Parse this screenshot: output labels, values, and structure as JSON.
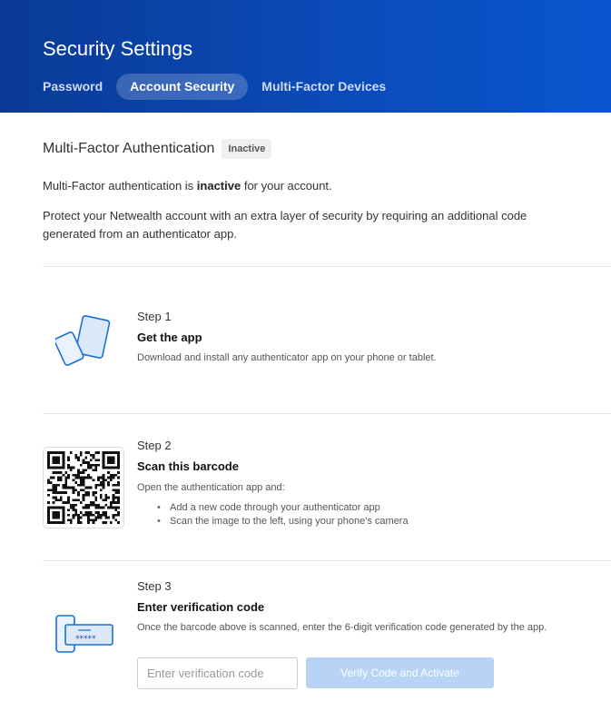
{
  "header": {
    "title": "Security Settings",
    "tabs": [
      {
        "label": "Password",
        "active": false
      },
      {
        "label": "Account Security",
        "active": true
      },
      {
        "label": "Multi-Factor Devices",
        "active": false
      }
    ]
  },
  "mfa": {
    "title": "Multi-Factor Authentication",
    "badge": "Inactive",
    "status_prefix": "Multi-Factor authentication is ",
    "status_value": "inactive",
    "status_suffix": " for your account.",
    "protect_text": "Protect your Netwealth account with an extra layer of security by requiring an additional code generated from an authenticator app."
  },
  "steps": [
    {
      "number": "Step 1",
      "title": "Get the app",
      "description": "Download and install any authenticator app on your phone or tablet.",
      "icon": "devices-icon"
    },
    {
      "number": "Step 2",
      "title": "Scan this barcode",
      "description": "Open the authentication app and:",
      "bullets": [
        "Add a new code through your authenticator app",
        "Scan the image to the left, using your phone's camera"
      ],
      "icon": "qr-code"
    },
    {
      "number": "Step 3",
      "title": "Enter verification code",
      "description": "Once the barcode above is scanned, enter the 6-digit verification code generated by the app.",
      "icon": "phone-code-icon",
      "icon_code_text": "*****"
    }
  ],
  "verify": {
    "input_value": "",
    "input_placeholder": "Enter verification code",
    "button_label": "Verify Code and Activate"
  },
  "colors": {
    "header_start": "#0a3a96",
    "header_end": "#0a55cf",
    "icon_blue": "#1a6fd9",
    "button_disabled": "#b7d4f7"
  }
}
